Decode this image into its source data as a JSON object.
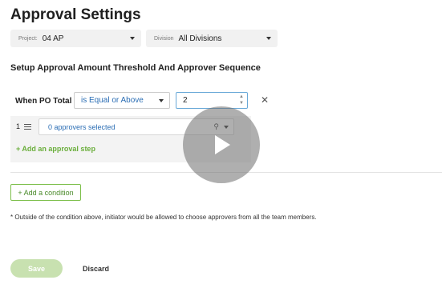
{
  "page": {
    "title": "Approval Settings"
  },
  "filters": {
    "project": {
      "label": "Project:",
      "value": "04 AP"
    },
    "division": {
      "label": "Division",
      "value": "All Divisions"
    }
  },
  "threshold": {
    "section_title": "Setup Approval Amount Threshold And Approver Sequence",
    "when_label": "When PO Total",
    "condition": "is Equal or Above",
    "amount": "2",
    "clear_icon": "close-icon"
  },
  "steps": [
    {
      "number": "1",
      "approvers": "0 approvers selected"
    }
  ],
  "add_step_label": "+ Add an approval step",
  "add_condition_label": "+ Add a condition",
  "footnote": "* Outside of the condition above, initiator would be allowed to choose approvers from all the team members.",
  "actions": {
    "save": "Save",
    "discard": "Discard"
  },
  "colors": {
    "accent_green": "#6aae3b",
    "link_blue": "#2a6db4"
  },
  "overlay": {
    "icon": "play-icon"
  }
}
